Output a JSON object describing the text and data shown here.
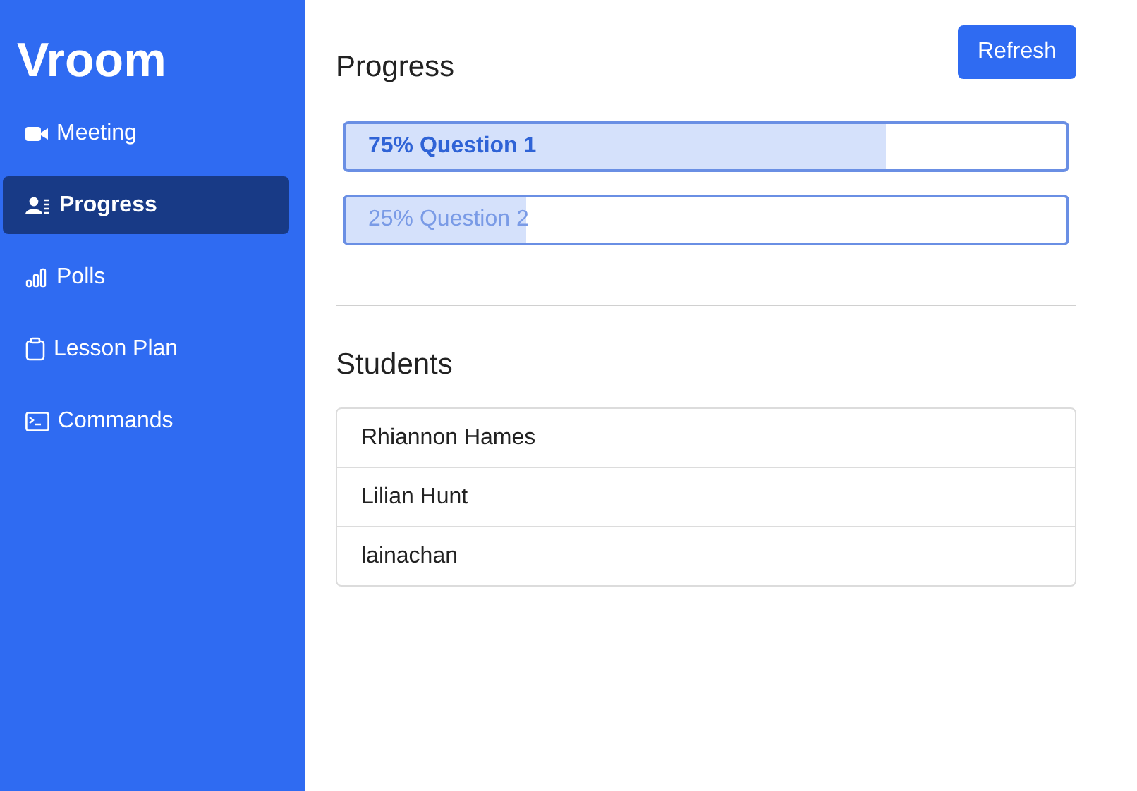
{
  "sidebar": {
    "brand": "Vroom",
    "items": [
      {
        "label": "Meeting",
        "selected": false
      },
      {
        "label": "Progress",
        "selected": true
      },
      {
        "label": "Polls",
        "selected": false
      },
      {
        "label": "Lesson Plan",
        "selected": false
      },
      {
        "label": "Commands",
        "selected": false
      }
    ]
  },
  "main": {
    "title": "Progress",
    "refresh_button": "Refresh",
    "questions": [
      {
        "label": "75% Question 1",
        "level": 0.75,
        "selected": true
      },
      {
        "label": "25% Question 2",
        "level": 0.25,
        "selected": false
      }
    ],
    "students_title": "Students",
    "students": [
      "Rhiannon Hames",
      "Lilian Hunt",
      "lainachan"
    ]
  }
}
